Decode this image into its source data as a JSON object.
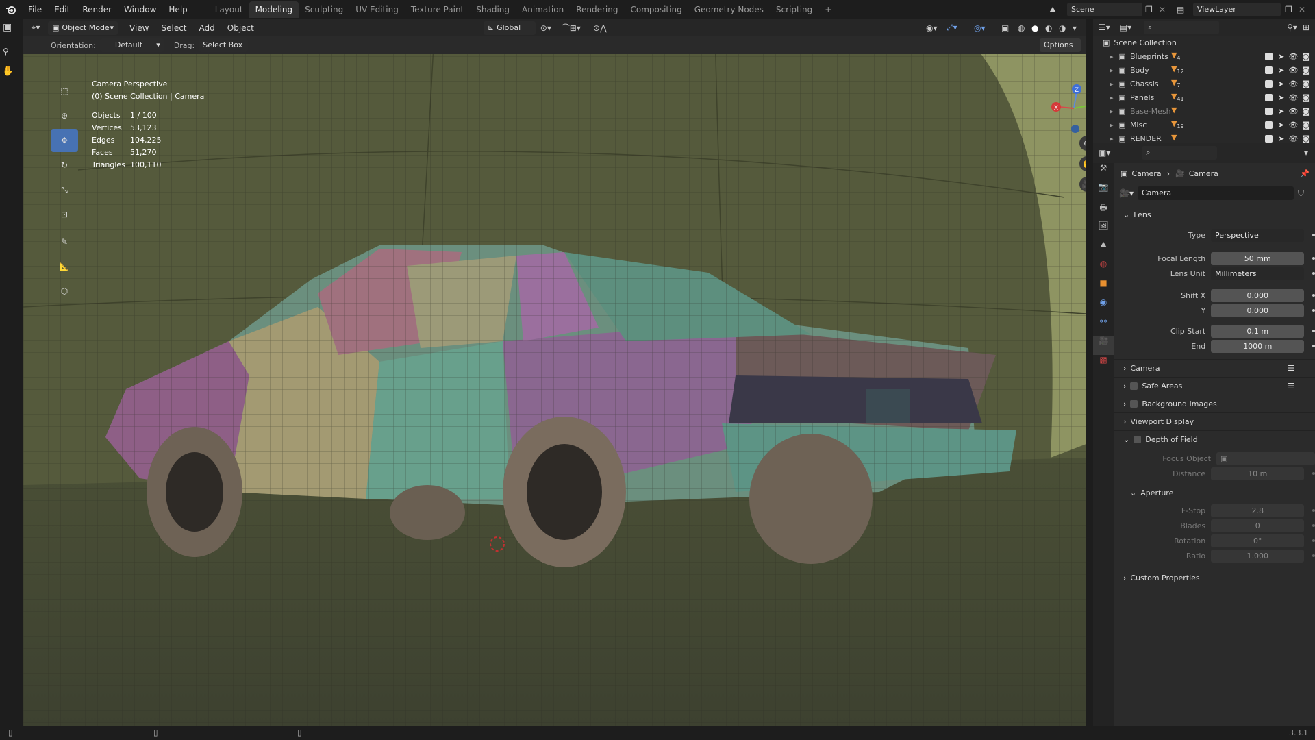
{
  "menu": {
    "items": [
      "File",
      "Edit",
      "Render",
      "Window",
      "Help"
    ]
  },
  "workspaces": [
    "Layout",
    "Modeling",
    "Sculpting",
    "UV Editing",
    "Texture Paint",
    "Shading",
    "Animation",
    "Rendering",
    "Compositing",
    "Geometry Nodes",
    "Scripting"
  ],
  "active_workspace": "Modeling",
  "add_tab": "+",
  "scene": "Scene",
  "view_layer": "ViewLayer",
  "vp_header": {
    "mode": "Object Mode",
    "menus": [
      "View",
      "Select",
      "Add",
      "Object"
    ],
    "transform": "Global"
  },
  "tool_header": {
    "orientation_label": "Orientation:",
    "orientation": "Default",
    "drag_label": "Drag:",
    "drag": "Select Box",
    "options": "Options"
  },
  "overlay": {
    "title": "Camera Perspective",
    "subtitle": "(0) Scene Collection | Camera"
  },
  "stats": [
    {
      "k": "Objects",
      "v": "1 / 100"
    },
    {
      "k": "Vertices",
      "v": "53,123"
    },
    {
      "k": "Edges",
      "v": "104,225"
    },
    {
      "k": "Faces",
      "v": "51,270"
    },
    {
      "k": "Triangles",
      "v": "100,110"
    }
  ],
  "gizmo": {
    "x": "X",
    "y": "Y",
    "z": "Z"
  },
  "outliner": {
    "root": "Scene Collection",
    "items": [
      {
        "name": "Blueprints",
        "count": "4"
      },
      {
        "name": "Body",
        "count": "12"
      },
      {
        "name": "Chassis",
        "count": "7"
      },
      {
        "name": "Panels",
        "count": "41"
      },
      {
        "name": "Base-Mesh",
        "count": ""
      },
      {
        "name": "Misc",
        "count": "19"
      },
      {
        "name": "RENDER",
        "count": ""
      }
    ]
  },
  "props": {
    "breadcrumb": [
      "Camera",
      "Camera"
    ],
    "datablock": "Camera",
    "lens": {
      "title": "Lens",
      "type_label": "Type",
      "type": "Perspective",
      "focal_label": "Focal Length",
      "focal": "50 mm",
      "unit_label": "Lens Unit",
      "unit": "Millimeters",
      "shiftx_label": "Shift X",
      "shiftx": "0.000",
      "shifty_label": "Y",
      "shifty": "0.000",
      "clipstart_label": "Clip Start",
      "clipstart": "0.1 m",
      "clipend_label": "End",
      "clipend": "1000 m"
    },
    "sections": [
      "Camera",
      "Safe Areas",
      "Background Images",
      "Viewport Display"
    ],
    "dof": {
      "title": "Depth of Field",
      "focus_label": "Focus Object",
      "distance_label": "Distance",
      "distance": "10 m",
      "aperture": "Aperture",
      "fstop_label": "F-Stop",
      "fstop": "2.8",
      "blades_label": "Blades",
      "blades": "0",
      "rotation_label": "Rotation",
      "rotation": "0°",
      "ratio_label": "Ratio",
      "ratio": "1.000"
    },
    "custom": "Custom Properties"
  },
  "version": "3.3.1",
  "colors": {
    "accent": "#4772b3",
    "viewport_bg": "#4f5337",
    "panel": "#2b2b2b"
  }
}
